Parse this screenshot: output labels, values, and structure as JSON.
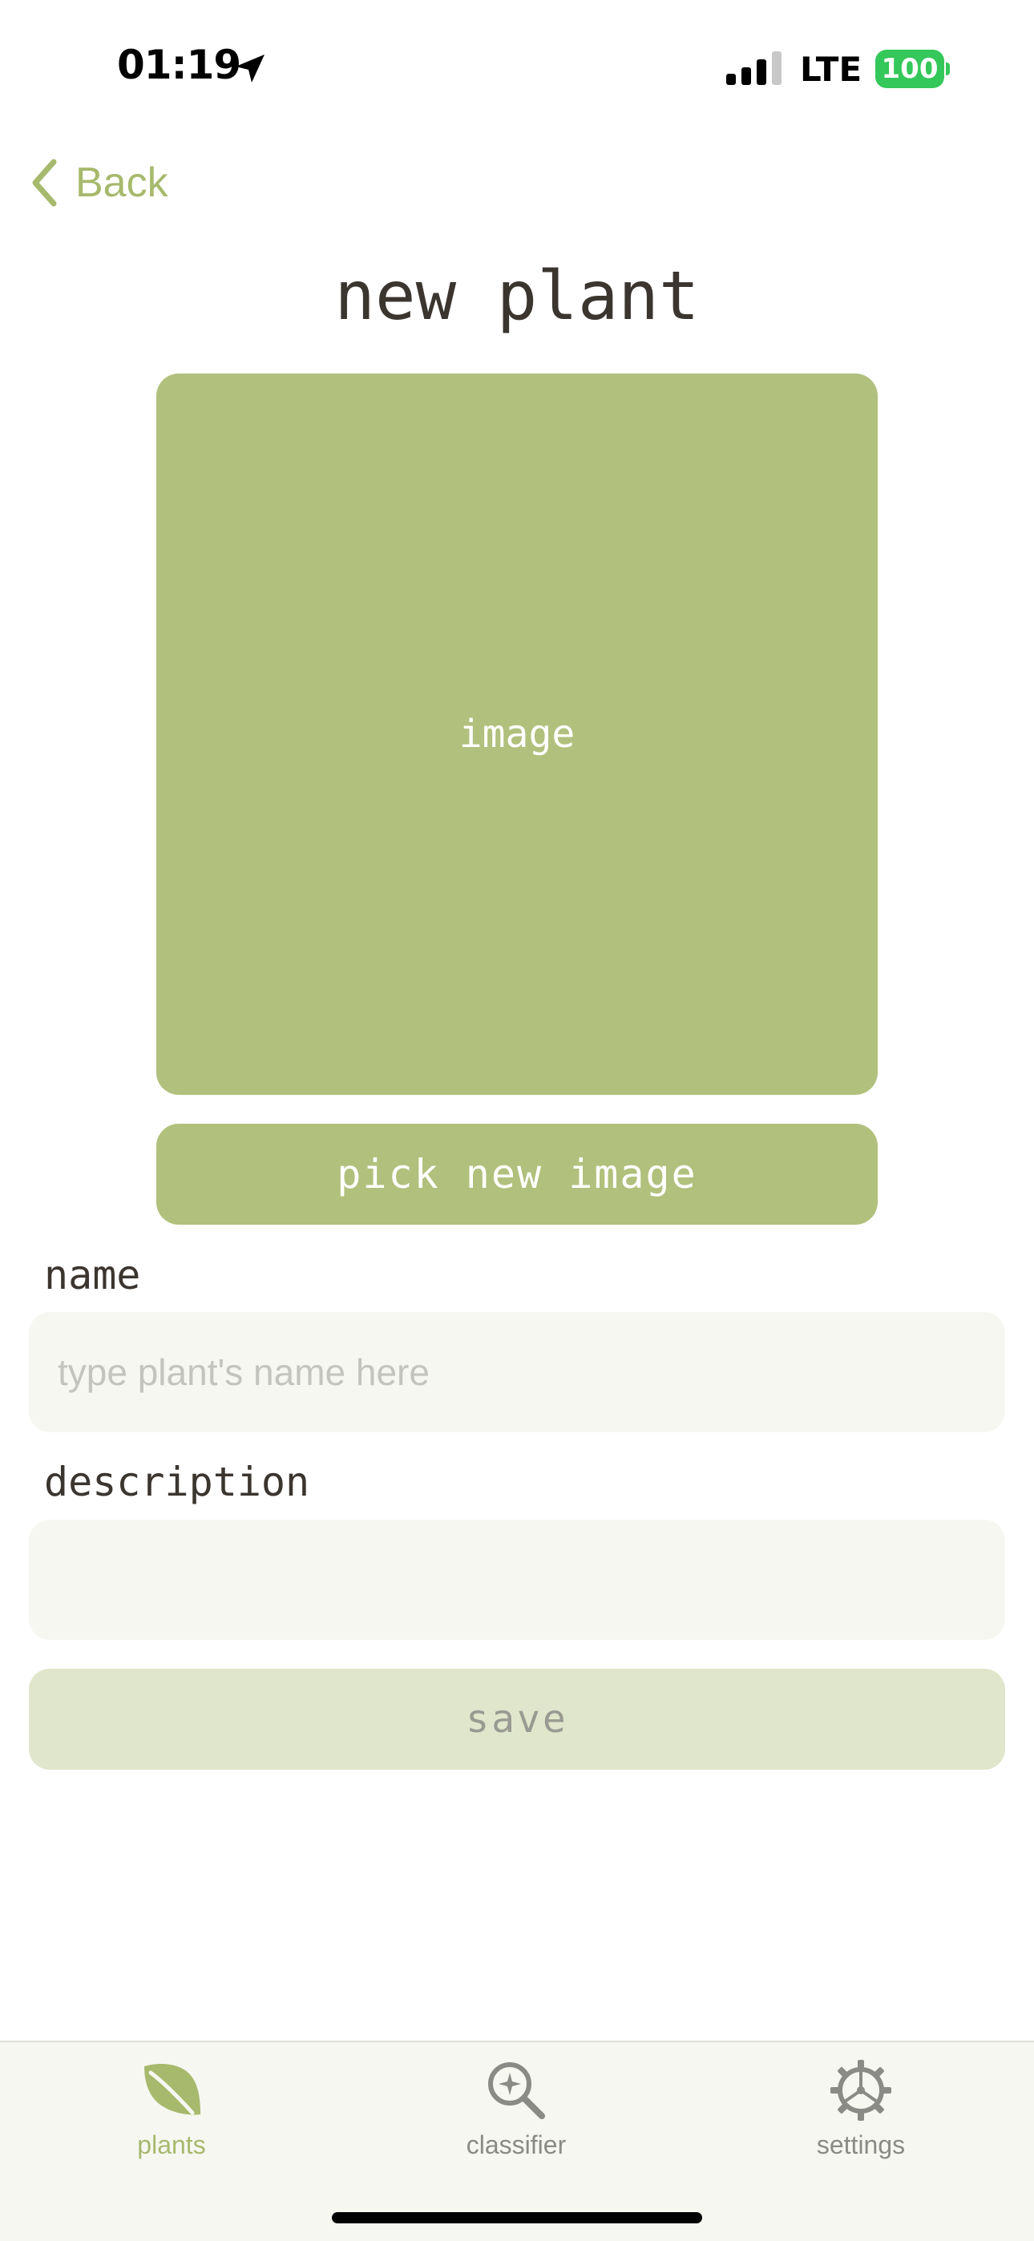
{
  "status_bar": {
    "time": "01:19",
    "network": "LTE",
    "battery": "100"
  },
  "nav": {
    "back_label": "Back"
  },
  "page": {
    "title": "new plant"
  },
  "image_area": {
    "placeholder_label": "image",
    "pick_button_label": "pick new image"
  },
  "form": {
    "name_label": "name",
    "name_placeholder": "type plant's name here",
    "name_value": "",
    "description_label": "description",
    "description_placeholder": "",
    "description_value": "",
    "save_label": "save"
  },
  "tab_bar": {
    "selected": "plants",
    "tabs": [
      {
        "label": "plants",
        "icon": "leaf-icon"
      },
      {
        "label": "classifier",
        "icon": "magnifier-sparkle-icon"
      },
      {
        "label": "settings",
        "icon": "gear-icon"
      }
    ]
  },
  "colors": {
    "accent": "#b1c07c",
    "accent_text": "#a7b96c",
    "text": "#3b3530",
    "field_bg": "#f6f7f1",
    "save_disabled_bg": "#e0e6cb",
    "battery": "#34c759"
  }
}
